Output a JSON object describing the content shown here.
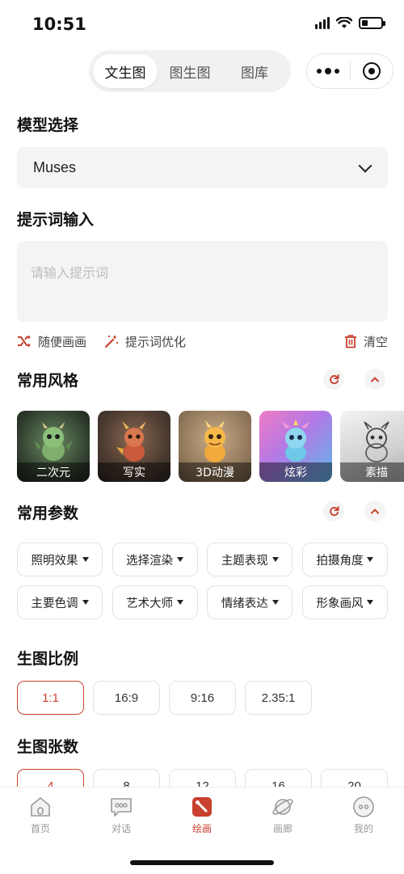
{
  "status_bar": {
    "time": "10:51"
  },
  "top_tabs": [
    {
      "label": "文生图",
      "active": true
    },
    {
      "label": "图生图",
      "active": false
    },
    {
      "label": "图库",
      "active": false
    }
  ],
  "capsule": {
    "more_icon": "more-dots-icon",
    "close_icon": "target-icon"
  },
  "model": {
    "heading": "模型选择",
    "selected": "Muses"
  },
  "prompt": {
    "heading": "提示词输入",
    "value": "",
    "placeholder": "请输入提示词",
    "actions": {
      "random": "随便画画",
      "optimize": "提示词优化",
      "clear": "清空"
    }
  },
  "styles": {
    "heading": "常用风格",
    "items": [
      {
        "label": "二次元"
      },
      {
        "label": "写实"
      },
      {
        "label": "3D动漫"
      },
      {
        "label": "炫彩"
      },
      {
        "label": "素描"
      }
    ]
  },
  "params": {
    "heading": "常用参数",
    "row1": [
      "照明效果",
      "选择渲染",
      "主题表现",
      "拍摄角度"
    ],
    "row2": [
      "主要色调",
      "艺术大师",
      "情绪表达",
      "形象画风"
    ]
  },
  "ratio": {
    "heading": "生图比例",
    "options": [
      "1:1",
      "16:9",
      "9:16",
      "2.35:1"
    ],
    "selected": "1:1"
  },
  "count": {
    "heading": "生图张数",
    "options": [
      "4",
      "8",
      "12",
      "16",
      "20"
    ],
    "selected": "4"
  },
  "bottom_nav": [
    {
      "label": "首页",
      "icon": "home-icon",
      "active": false
    },
    {
      "label": "对话",
      "icon": "chat-icon",
      "active": false
    },
    {
      "label": "绘画",
      "icon": "paint-brush-icon",
      "active": true
    },
    {
      "label": "画廊",
      "icon": "planet-icon",
      "active": false
    },
    {
      "label": "我的",
      "icon": "profile-icon",
      "active": false
    }
  ],
  "colors": {
    "accent": "#c8412f",
    "input_bg": "#f4f4f4",
    "border": "#e3e3e3"
  }
}
